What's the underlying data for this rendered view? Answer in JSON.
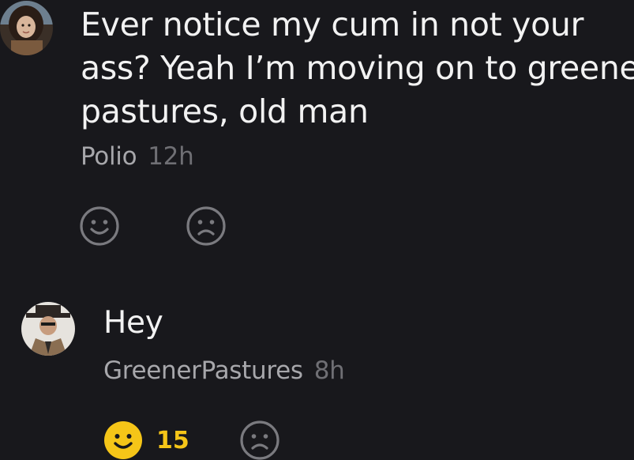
{
  "comments": [
    {
      "avatar_icon": "user-avatar-icon",
      "text_lines": [
        "Ever notice my cum in not your",
        "ass? Yeah I’m moving on to greener",
        "pastures, old man"
      ],
      "author": "Polio",
      "time": "12h",
      "like_count": null,
      "like_active": false
    },
    {
      "avatar_icon": "user-avatar-icon",
      "text": "Hey",
      "author": "GreenerPastures",
      "time": "8h",
      "like_count": "15",
      "like_active": true
    }
  ],
  "icons": {
    "like": "smiley-face-icon",
    "dislike": "frown-face-icon"
  },
  "colors": {
    "background": "#18181c",
    "text": "#f2f2f2",
    "author": "#a7a7ab",
    "time": "#6f6f74",
    "icon_inactive": "#7a7a7f",
    "like_active": "#f5c518"
  }
}
